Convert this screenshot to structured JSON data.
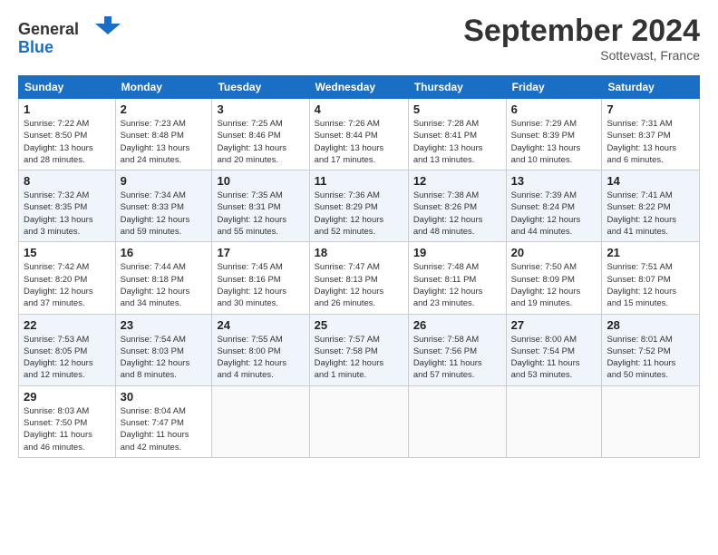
{
  "logo": {
    "line1": "General",
    "line2": "Blue"
  },
  "title": "September 2024",
  "subtitle": "Sottevast, France",
  "header_days": [
    "Sunday",
    "Monday",
    "Tuesday",
    "Wednesday",
    "Thursday",
    "Friday",
    "Saturday"
  ],
  "weeks": [
    [
      {
        "day": "1",
        "info": "Sunrise: 7:22 AM\nSunset: 8:50 PM\nDaylight: 13 hours\nand 28 minutes."
      },
      {
        "day": "2",
        "info": "Sunrise: 7:23 AM\nSunset: 8:48 PM\nDaylight: 13 hours\nand 24 minutes."
      },
      {
        "day": "3",
        "info": "Sunrise: 7:25 AM\nSunset: 8:46 PM\nDaylight: 13 hours\nand 20 minutes."
      },
      {
        "day": "4",
        "info": "Sunrise: 7:26 AM\nSunset: 8:44 PM\nDaylight: 13 hours\nand 17 minutes."
      },
      {
        "day": "5",
        "info": "Sunrise: 7:28 AM\nSunset: 8:41 PM\nDaylight: 13 hours\nand 13 minutes."
      },
      {
        "day": "6",
        "info": "Sunrise: 7:29 AM\nSunset: 8:39 PM\nDaylight: 13 hours\nand 10 minutes."
      },
      {
        "day": "7",
        "info": "Sunrise: 7:31 AM\nSunset: 8:37 PM\nDaylight: 13 hours\nand 6 minutes."
      }
    ],
    [
      {
        "day": "8",
        "info": "Sunrise: 7:32 AM\nSunset: 8:35 PM\nDaylight: 13 hours\nand 3 minutes."
      },
      {
        "day": "9",
        "info": "Sunrise: 7:34 AM\nSunset: 8:33 PM\nDaylight: 12 hours\nand 59 minutes."
      },
      {
        "day": "10",
        "info": "Sunrise: 7:35 AM\nSunset: 8:31 PM\nDaylight: 12 hours\nand 55 minutes."
      },
      {
        "day": "11",
        "info": "Sunrise: 7:36 AM\nSunset: 8:29 PM\nDaylight: 12 hours\nand 52 minutes."
      },
      {
        "day": "12",
        "info": "Sunrise: 7:38 AM\nSunset: 8:26 PM\nDaylight: 12 hours\nand 48 minutes."
      },
      {
        "day": "13",
        "info": "Sunrise: 7:39 AM\nSunset: 8:24 PM\nDaylight: 12 hours\nand 44 minutes."
      },
      {
        "day": "14",
        "info": "Sunrise: 7:41 AM\nSunset: 8:22 PM\nDaylight: 12 hours\nand 41 minutes."
      }
    ],
    [
      {
        "day": "15",
        "info": "Sunrise: 7:42 AM\nSunset: 8:20 PM\nDaylight: 12 hours\nand 37 minutes."
      },
      {
        "day": "16",
        "info": "Sunrise: 7:44 AM\nSunset: 8:18 PM\nDaylight: 12 hours\nand 34 minutes."
      },
      {
        "day": "17",
        "info": "Sunrise: 7:45 AM\nSunset: 8:16 PM\nDaylight: 12 hours\nand 30 minutes."
      },
      {
        "day": "18",
        "info": "Sunrise: 7:47 AM\nSunset: 8:13 PM\nDaylight: 12 hours\nand 26 minutes."
      },
      {
        "day": "19",
        "info": "Sunrise: 7:48 AM\nSunset: 8:11 PM\nDaylight: 12 hours\nand 23 minutes."
      },
      {
        "day": "20",
        "info": "Sunrise: 7:50 AM\nSunset: 8:09 PM\nDaylight: 12 hours\nand 19 minutes."
      },
      {
        "day": "21",
        "info": "Sunrise: 7:51 AM\nSunset: 8:07 PM\nDaylight: 12 hours\nand 15 minutes."
      }
    ],
    [
      {
        "day": "22",
        "info": "Sunrise: 7:53 AM\nSunset: 8:05 PM\nDaylight: 12 hours\nand 12 minutes."
      },
      {
        "day": "23",
        "info": "Sunrise: 7:54 AM\nSunset: 8:03 PM\nDaylight: 12 hours\nand 8 minutes."
      },
      {
        "day": "24",
        "info": "Sunrise: 7:55 AM\nSunset: 8:00 PM\nDaylight: 12 hours\nand 4 minutes."
      },
      {
        "day": "25",
        "info": "Sunrise: 7:57 AM\nSunset: 7:58 PM\nDaylight: 12 hours\nand 1 minute."
      },
      {
        "day": "26",
        "info": "Sunrise: 7:58 AM\nSunset: 7:56 PM\nDaylight: 11 hours\nand 57 minutes."
      },
      {
        "day": "27",
        "info": "Sunrise: 8:00 AM\nSunset: 7:54 PM\nDaylight: 11 hours\nand 53 minutes."
      },
      {
        "day": "28",
        "info": "Sunrise: 8:01 AM\nSunset: 7:52 PM\nDaylight: 11 hours\nand 50 minutes."
      }
    ],
    [
      {
        "day": "29",
        "info": "Sunrise: 8:03 AM\nSunset: 7:50 PM\nDaylight: 11 hours\nand 46 minutes."
      },
      {
        "day": "30",
        "info": "Sunrise: 8:04 AM\nSunset: 7:47 PM\nDaylight: 11 hours\nand 42 minutes."
      },
      {
        "day": "",
        "info": ""
      },
      {
        "day": "",
        "info": ""
      },
      {
        "day": "",
        "info": ""
      },
      {
        "day": "",
        "info": ""
      },
      {
        "day": "",
        "info": ""
      }
    ]
  ]
}
